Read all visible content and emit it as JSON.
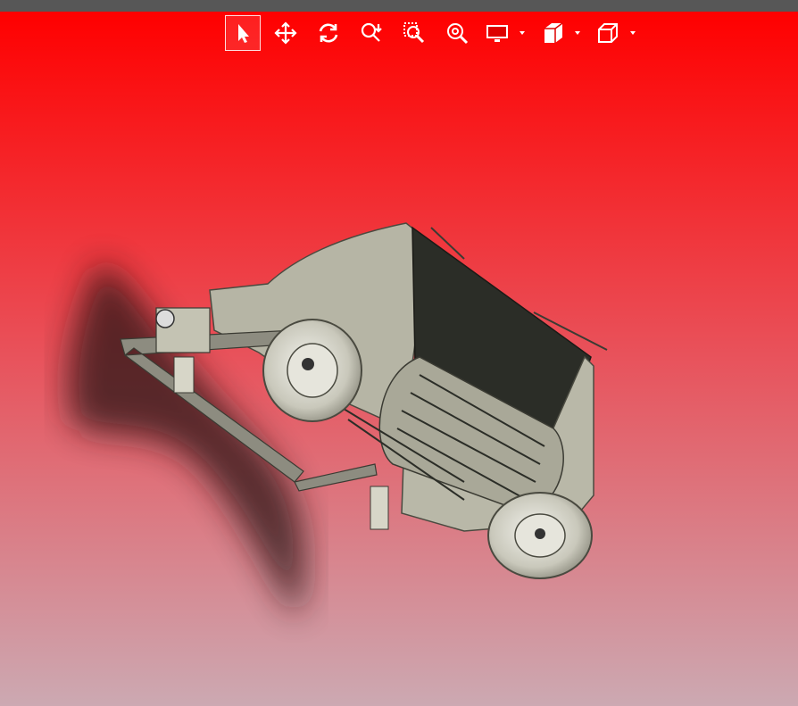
{
  "colors": {
    "title_bar": "#575757",
    "background_top": "#ff0000",
    "background_bottom": "#cca9b2",
    "toolbar_icon": "#ffffff",
    "model_body": "#b6b5a5",
    "model_dark": "#2b2d27",
    "model_shadow": "#2a1416"
  },
  "toolbar": {
    "buttons": [
      {
        "id": "select",
        "icon": "select-arrow-icon",
        "active": true
      },
      {
        "id": "pan",
        "icon": "pan-icon"
      },
      {
        "id": "rotate",
        "icon": "rotate-icon"
      },
      {
        "id": "zoom",
        "icon": "zoom-updown-icon"
      },
      {
        "id": "zoom-window",
        "icon": "zoom-window-icon"
      },
      {
        "id": "zoom-fit",
        "icon": "zoom-fit-icon"
      },
      {
        "id": "display-style",
        "icon": "monitor-icon",
        "dropdown": true
      },
      {
        "id": "section-view",
        "icon": "section-view-icon",
        "dropdown": true
      },
      {
        "id": "view-orientation",
        "icon": "cube-icon",
        "dropdown": true
      }
    ]
  },
  "model": {
    "description_icon": "agricultural-rotary-tiller-3d-model"
  }
}
